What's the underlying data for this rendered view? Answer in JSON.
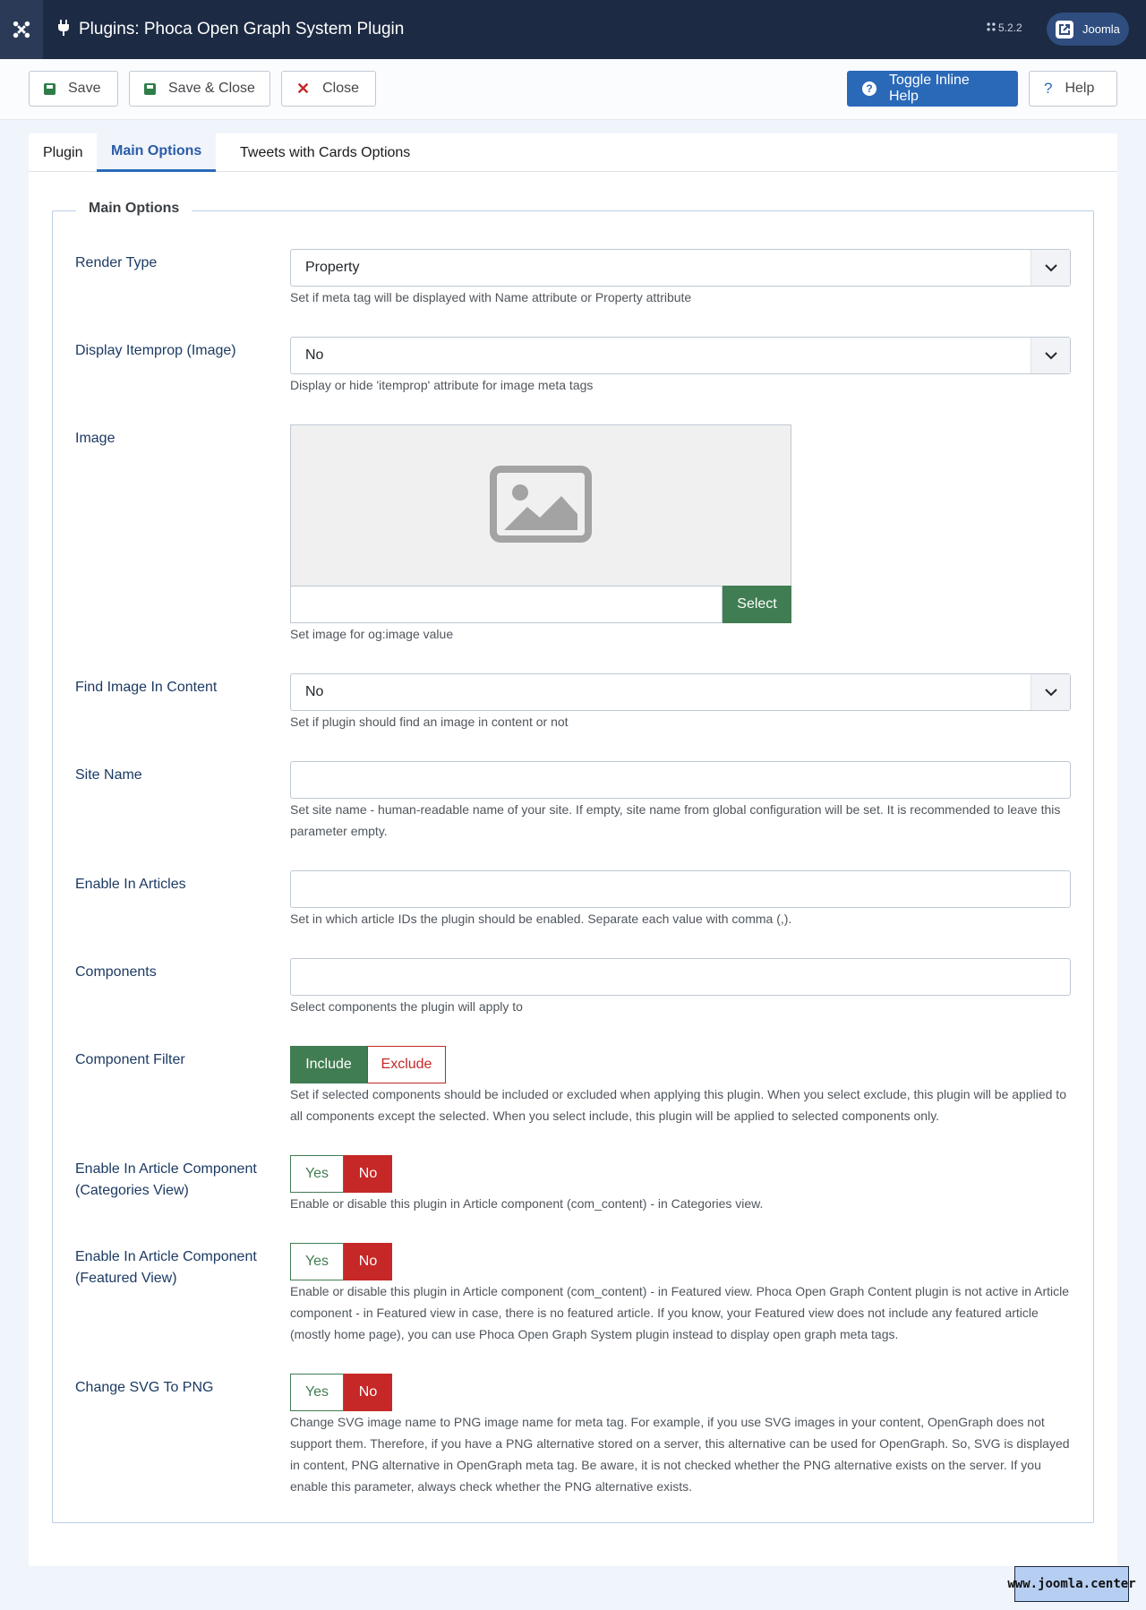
{
  "header": {
    "title": "Plugins: Phoca Open Graph System Plugin",
    "version": "5.2.2",
    "site_button": "Joomla",
    "logo_icon": "joomla-logo-icon",
    "title_icon": "plug-icon"
  },
  "toolbar": {
    "save": "Save",
    "save_close": "Save & Close",
    "close": "Close",
    "toggle_help": "Toggle Inline Help",
    "help": "Help"
  },
  "tabs": [
    {
      "label": "Plugin",
      "active": false
    },
    {
      "label": "Main Options",
      "active": true
    },
    {
      "label": "Tweets with Cards Options",
      "active": false
    }
  ],
  "fieldset": {
    "legend": "Main Options",
    "fields": {
      "render_type": {
        "label": "Render Type",
        "value": "Property",
        "desc": "Set if meta tag will be displayed with Name attribute or Property attribute"
      },
      "display_itemprop": {
        "label": "Display Itemprop (Image)",
        "value": "No",
        "desc": "Display or hide 'itemprop' attribute for image meta tags"
      },
      "image": {
        "label": "Image",
        "value": "",
        "select_button": "Select",
        "desc": "Set image for og:image value"
      },
      "find_image": {
        "label": "Find Image In Content",
        "value": "No",
        "desc": "Set if plugin should find an image in content or not"
      },
      "site_name": {
        "label": "Site Name",
        "value": "",
        "desc": "Set site name - human-readable name of your site. If empty, site name from global configuration will be set. It is recommended to leave this parameter empty."
      },
      "enable_articles": {
        "label": "Enable In Articles",
        "value": "",
        "desc": "Set in which article IDs the plugin should be enabled. Separate each value with comma (,)."
      },
      "components": {
        "label": "Components",
        "value": "",
        "desc": "Select components the plugin will apply to"
      },
      "component_filter": {
        "label": "Component Filter",
        "options": [
          "Include",
          "Exclude"
        ],
        "selected": "Include",
        "desc": "Set if selected components should be included or excluded when applying this plugin. When you select exclude, this plugin will be applied to all components except the selected. When you select include, this plugin will be applied to selected components only."
      },
      "categories_view": {
        "label_line1": "Enable In Article Component",
        "label_line2": "(Categories View)",
        "options": [
          "Yes",
          "No"
        ],
        "selected": "No",
        "desc": "Enable or disable this plugin in Article component (com_content) - in Categories view."
      },
      "featured_view": {
        "label_line1": "Enable In Article Component",
        "label_line2": "(Featured View)",
        "options": [
          "Yes",
          "No"
        ],
        "selected": "No",
        "desc": "Enable or disable this plugin in Article component (com_content) - in Featured view. Phoca Open Graph Content plugin is not active in Article component - in Featured view in case, there is no featured article. If you know, your Featured view does not include any featured article (mostly home page), you can use Phoca Open Graph System plugin instead to display open graph meta tags."
      },
      "svg_to_png": {
        "label": "Change SVG To PNG",
        "options": [
          "Yes",
          "No"
        ],
        "selected": "No",
        "desc": "Change SVG image name to PNG image name for meta tag. For example, if you use SVG images in your content, OpenGraph does not support them. Therefore, if you have a PNG alternative stored on a server, this alternative can be used for OpenGraph. So, SVG is displayed in content, PNG alternative in OpenGraph meta tag. Be aware, it is not checked whether the PNG alternative exists on the server. If you enable this parameter, always check whether the PNG alternative exists."
      }
    }
  },
  "watermark": "www.joomla.center",
  "colors": {
    "header_bg": "#1c2a43",
    "primary": "#2a69b8",
    "success": "#417d52",
    "danger": "#c52827"
  }
}
